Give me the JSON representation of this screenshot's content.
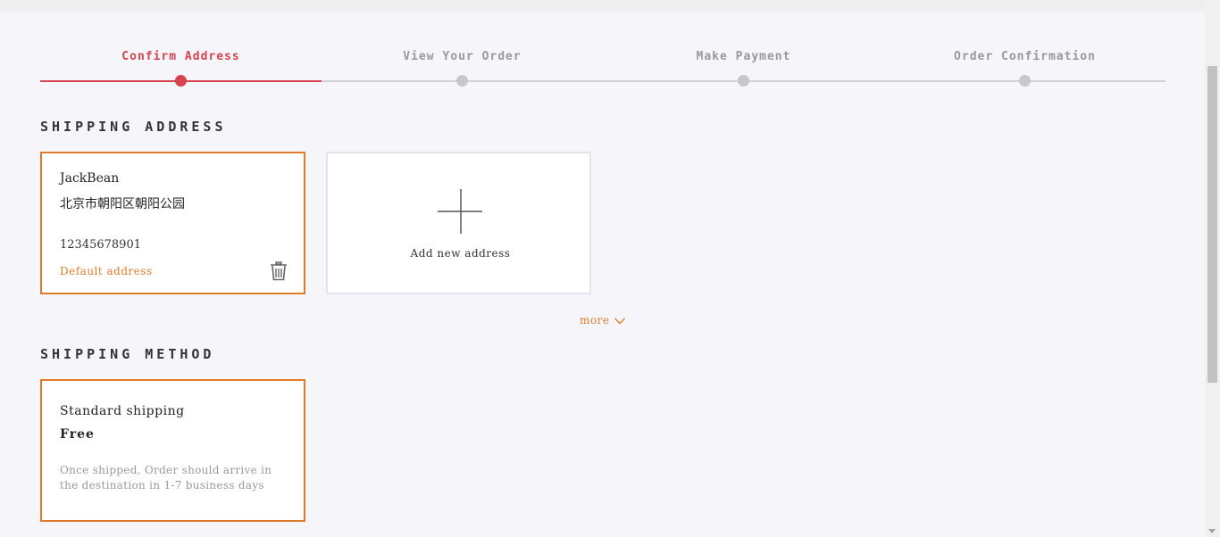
{
  "stepper": {
    "steps": [
      {
        "label": "Confirm Address",
        "active": true
      },
      {
        "label": "View Your Order",
        "active": false
      },
      {
        "label": "Make Payment",
        "active": false
      },
      {
        "label": "Order Confirmation",
        "active": false
      }
    ]
  },
  "shipping_address": {
    "title": "SHIPPING ADDRESS",
    "selected_card": {
      "name": "JackBean",
      "address": "北京市朝阳区朝阳公园",
      "phone": "12345678901",
      "default_label": "Default address",
      "delete_icon": "trash-icon"
    },
    "add_card": {
      "icon": "plus-icon",
      "label": "Add new address"
    },
    "more_label": "more"
  },
  "shipping_method": {
    "title": "SHIPPING METHOD",
    "option": {
      "name": "Standard shipping",
      "price": "Free",
      "description": "Once shipped, Order should arrive in the destination in 1-7 business days"
    }
  },
  "colors": {
    "accent_red": "#d9424f",
    "accent_orange": "#e07b2a",
    "inactive_gray": "#c8c8cc"
  }
}
